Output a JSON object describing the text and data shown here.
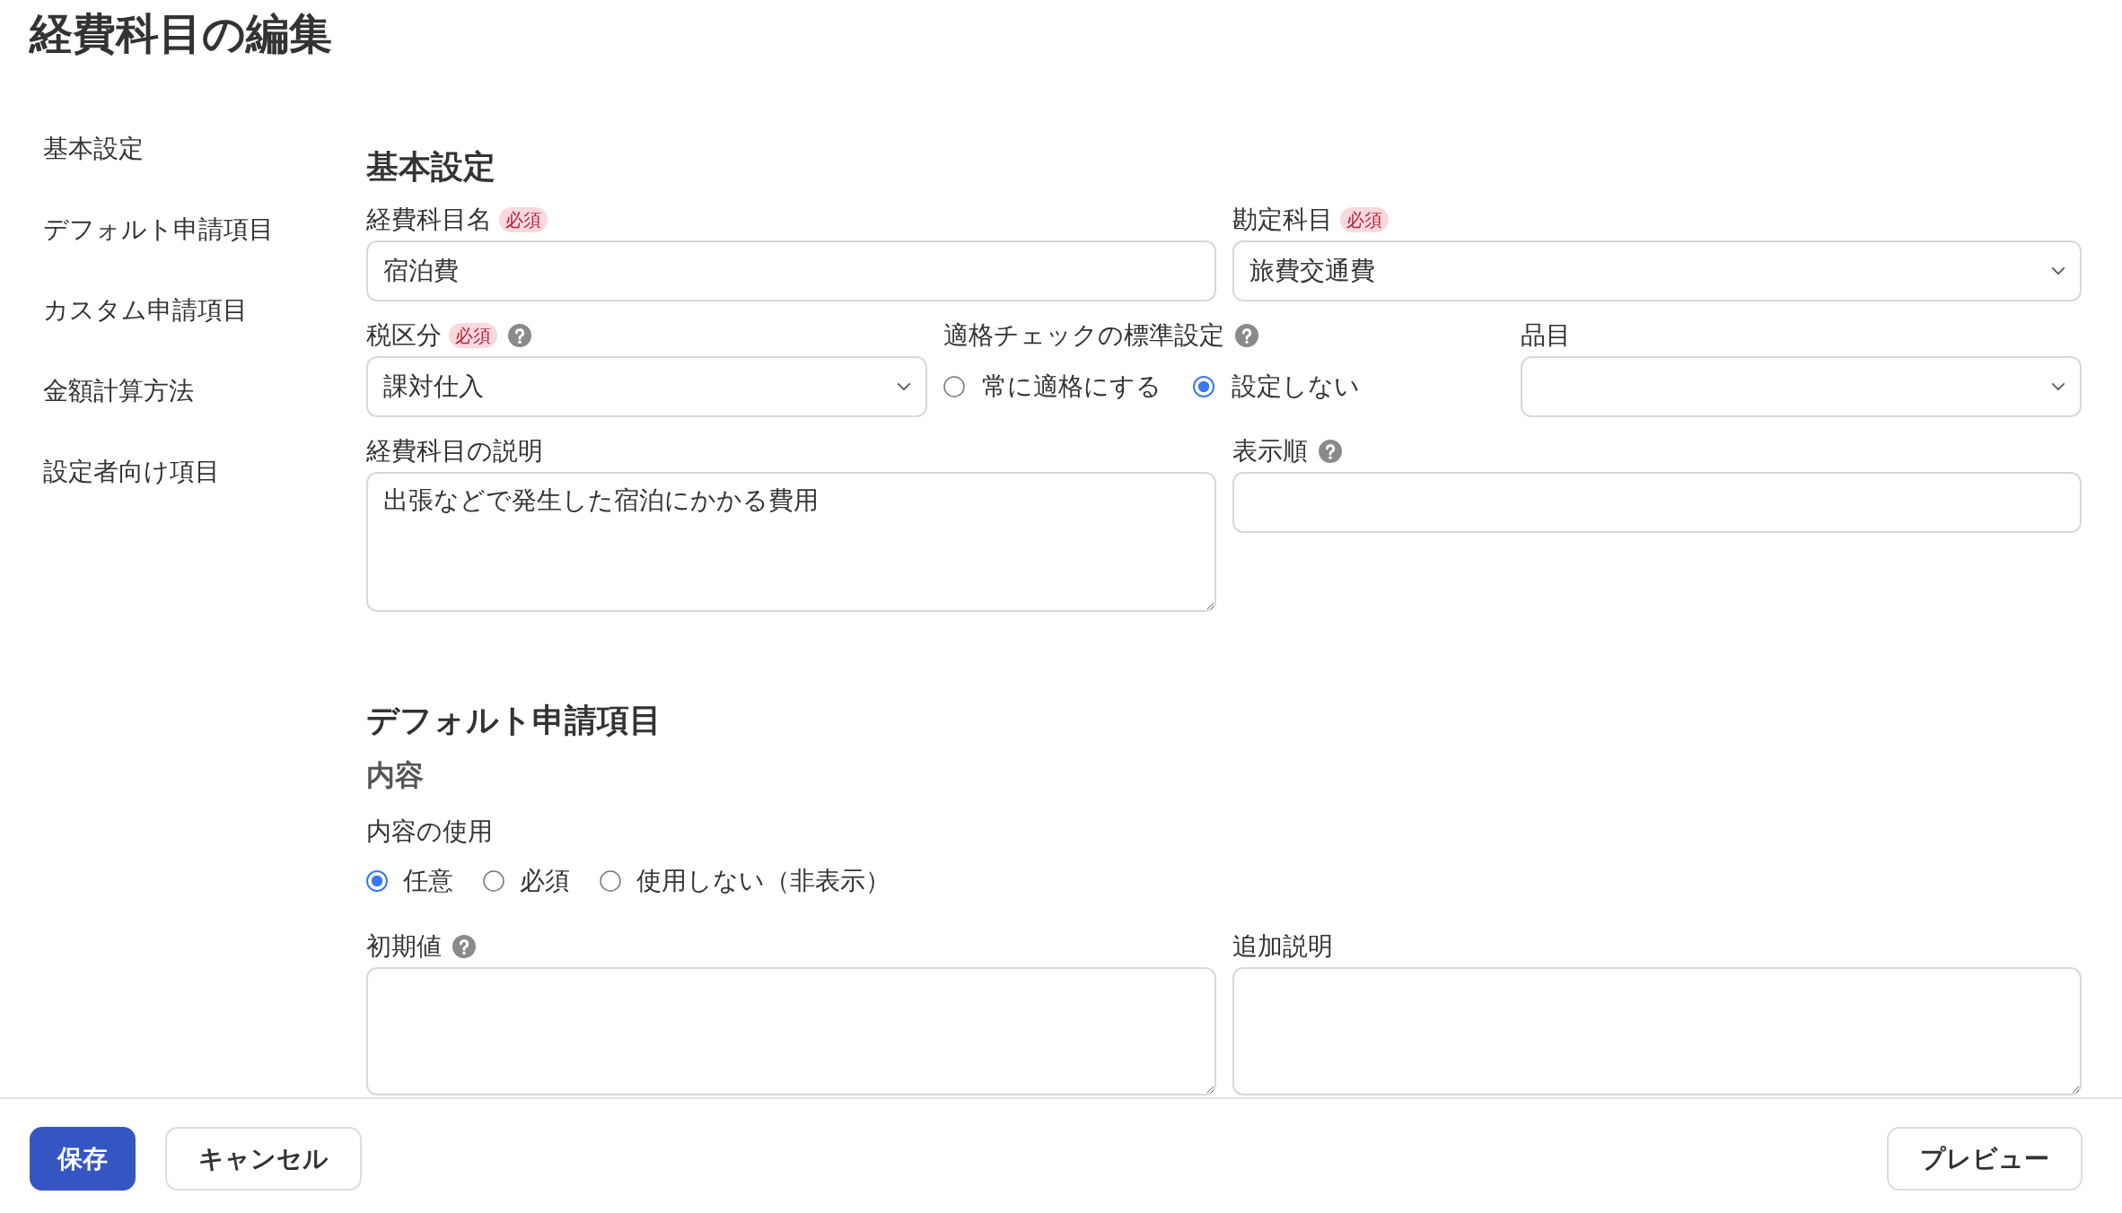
{
  "page": {
    "title": "経費科目の編集"
  },
  "sidebar": {
    "items": [
      "基本設定",
      "デフォルト申請項目",
      "カスタム申請項目",
      "金額計算方法",
      "設定者向け項目"
    ]
  },
  "basic_settings": {
    "heading": "基本設定",
    "rows": [
      {
        "fields": [
          {
            "kind": "text",
            "label": "経費科目名",
            "badge": "必須",
            "help": false,
            "value": "宿泊費"
          },
          {
            "kind": "select",
            "label": "勘定科目",
            "badge": "必須",
            "help": false,
            "value": "旅費交通費"
          }
        ]
      },
      {
        "fields": [
          {
            "kind": "select",
            "label": "税区分",
            "badge": "必須",
            "help": true,
            "value": "課対仕入"
          },
          {
            "kind": "radio",
            "label": "適格チェックの標準設定",
            "help": true,
            "options": [
              {
                "label": "常に適格にする",
                "selected": false
              },
              {
                "label": "設定しない",
                "selected": true
              }
            ]
          },
          {
            "kind": "select",
            "label": "品目",
            "help": false
          }
        ]
      },
      {
        "fields": [
          {
            "kind": "textarea",
            "label": "経費科目の説明",
            "help": false,
            "value": "出張などで発生した宿泊にかかる費用"
          },
          {
            "kind": "text",
            "label": "表示順",
            "help": true
          }
        ]
      }
    ]
  },
  "default_items": {
    "heading": "デフォルト申請項目",
    "subheading": "内容",
    "usage": {
      "label": "内容の使用",
      "options": [
        {
          "label": "任意",
          "selected": true
        },
        {
          "label": "必須",
          "selected": false
        },
        {
          "label": "使用しない（非表示）",
          "selected": false
        }
      ]
    },
    "rows": [
      {
        "fields": [
          {
            "kind": "textarea",
            "label": "初期値",
            "help": true
          },
          {
            "kind": "textarea",
            "label": "追加説明",
            "help": false
          }
        ]
      }
    ]
  },
  "footer": {
    "left_buttons": [
      {
        "label": "保存",
        "kind": "primary"
      },
      {
        "label": "キャンセル",
        "kind": "secondary"
      }
    ],
    "right_buttons": [
      {
        "label": "プレビュー",
        "kind": "secondary"
      }
    ]
  }
}
